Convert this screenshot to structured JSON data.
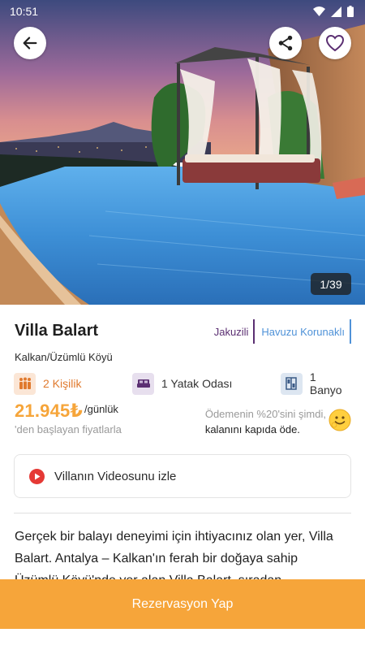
{
  "status_bar": {
    "time": "10:51"
  },
  "hero": {
    "photo_counter": "1/39"
  },
  "villa": {
    "name": "Villa Balart",
    "tags": [
      "Jakuzili",
      "Havuzu Korunaklı"
    ],
    "location": "Kalkan/Üzümlü Köyü"
  },
  "features": {
    "guests": "2 Kişilik",
    "bedrooms": "1 Yatak Odası",
    "bathrooms": "1 Banyo"
  },
  "pricing": {
    "price": "21.945₺",
    "unit": "/günlük",
    "note": "'den başlayan fiyatlarla",
    "payment_line1": "Ödemenin %20'sini şimdi,",
    "payment_line2": "kalanını kapıda öde."
  },
  "video_button": {
    "label": "Villanın Videosunu izle"
  },
  "description": "Gerçek bir balayı deneyimi için ihtiyacınız olan yer, Villa Balart. Antalya – Kalkan'ın ferah bir doğaya sahip Üzümlü Köyü'nde yer alan Villa Balart, sıradan",
  "reserve_button": {
    "label": "Rezervasyon Yap"
  },
  "colors": {
    "accent": "#f6a53a",
    "title_tag": "#5b2f72",
    "blue_tag": "#4f92d8",
    "video_icon": "#e53935"
  },
  "icons": [
    "back-arrow-icon",
    "share-icon",
    "heart-icon",
    "people-icon",
    "bed-icon",
    "door-icon",
    "play-icon",
    "smile-emoji-icon",
    "wifi-icon",
    "signal-icon",
    "battery-icon"
  ]
}
